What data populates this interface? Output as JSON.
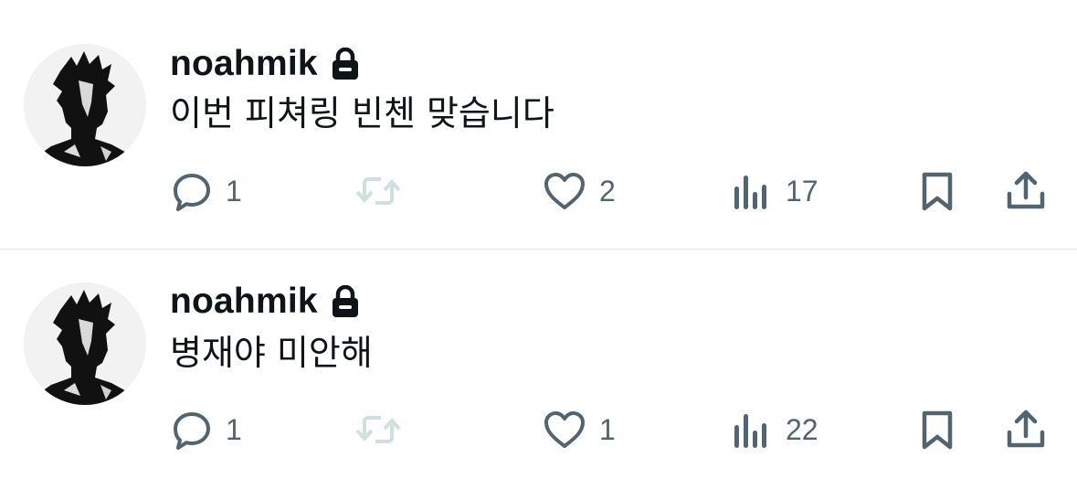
{
  "posts": [
    {
      "username": "noahmik",
      "locked": true,
      "icons": {
        "lock": "lock-icon"
      },
      "text": "이번 피쳐링 빈첸 맞습니다",
      "actions": {
        "replies": "1",
        "reposts": "",
        "likes": "2",
        "views": "17"
      }
    },
    {
      "username": "noahmik",
      "locked": true,
      "icons": {
        "lock": "lock-icon"
      },
      "text": "병재야 미안해",
      "actions": {
        "replies": "1",
        "reposts": "",
        "likes": "1",
        "views": "22"
      }
    }
  ],
  "colors": {
    "text": "#0f1419",
    "muted": "#536471",
    "repost_disabled": "#cfe0e0",
    "divider": "#e3e7ea"
  }
}
